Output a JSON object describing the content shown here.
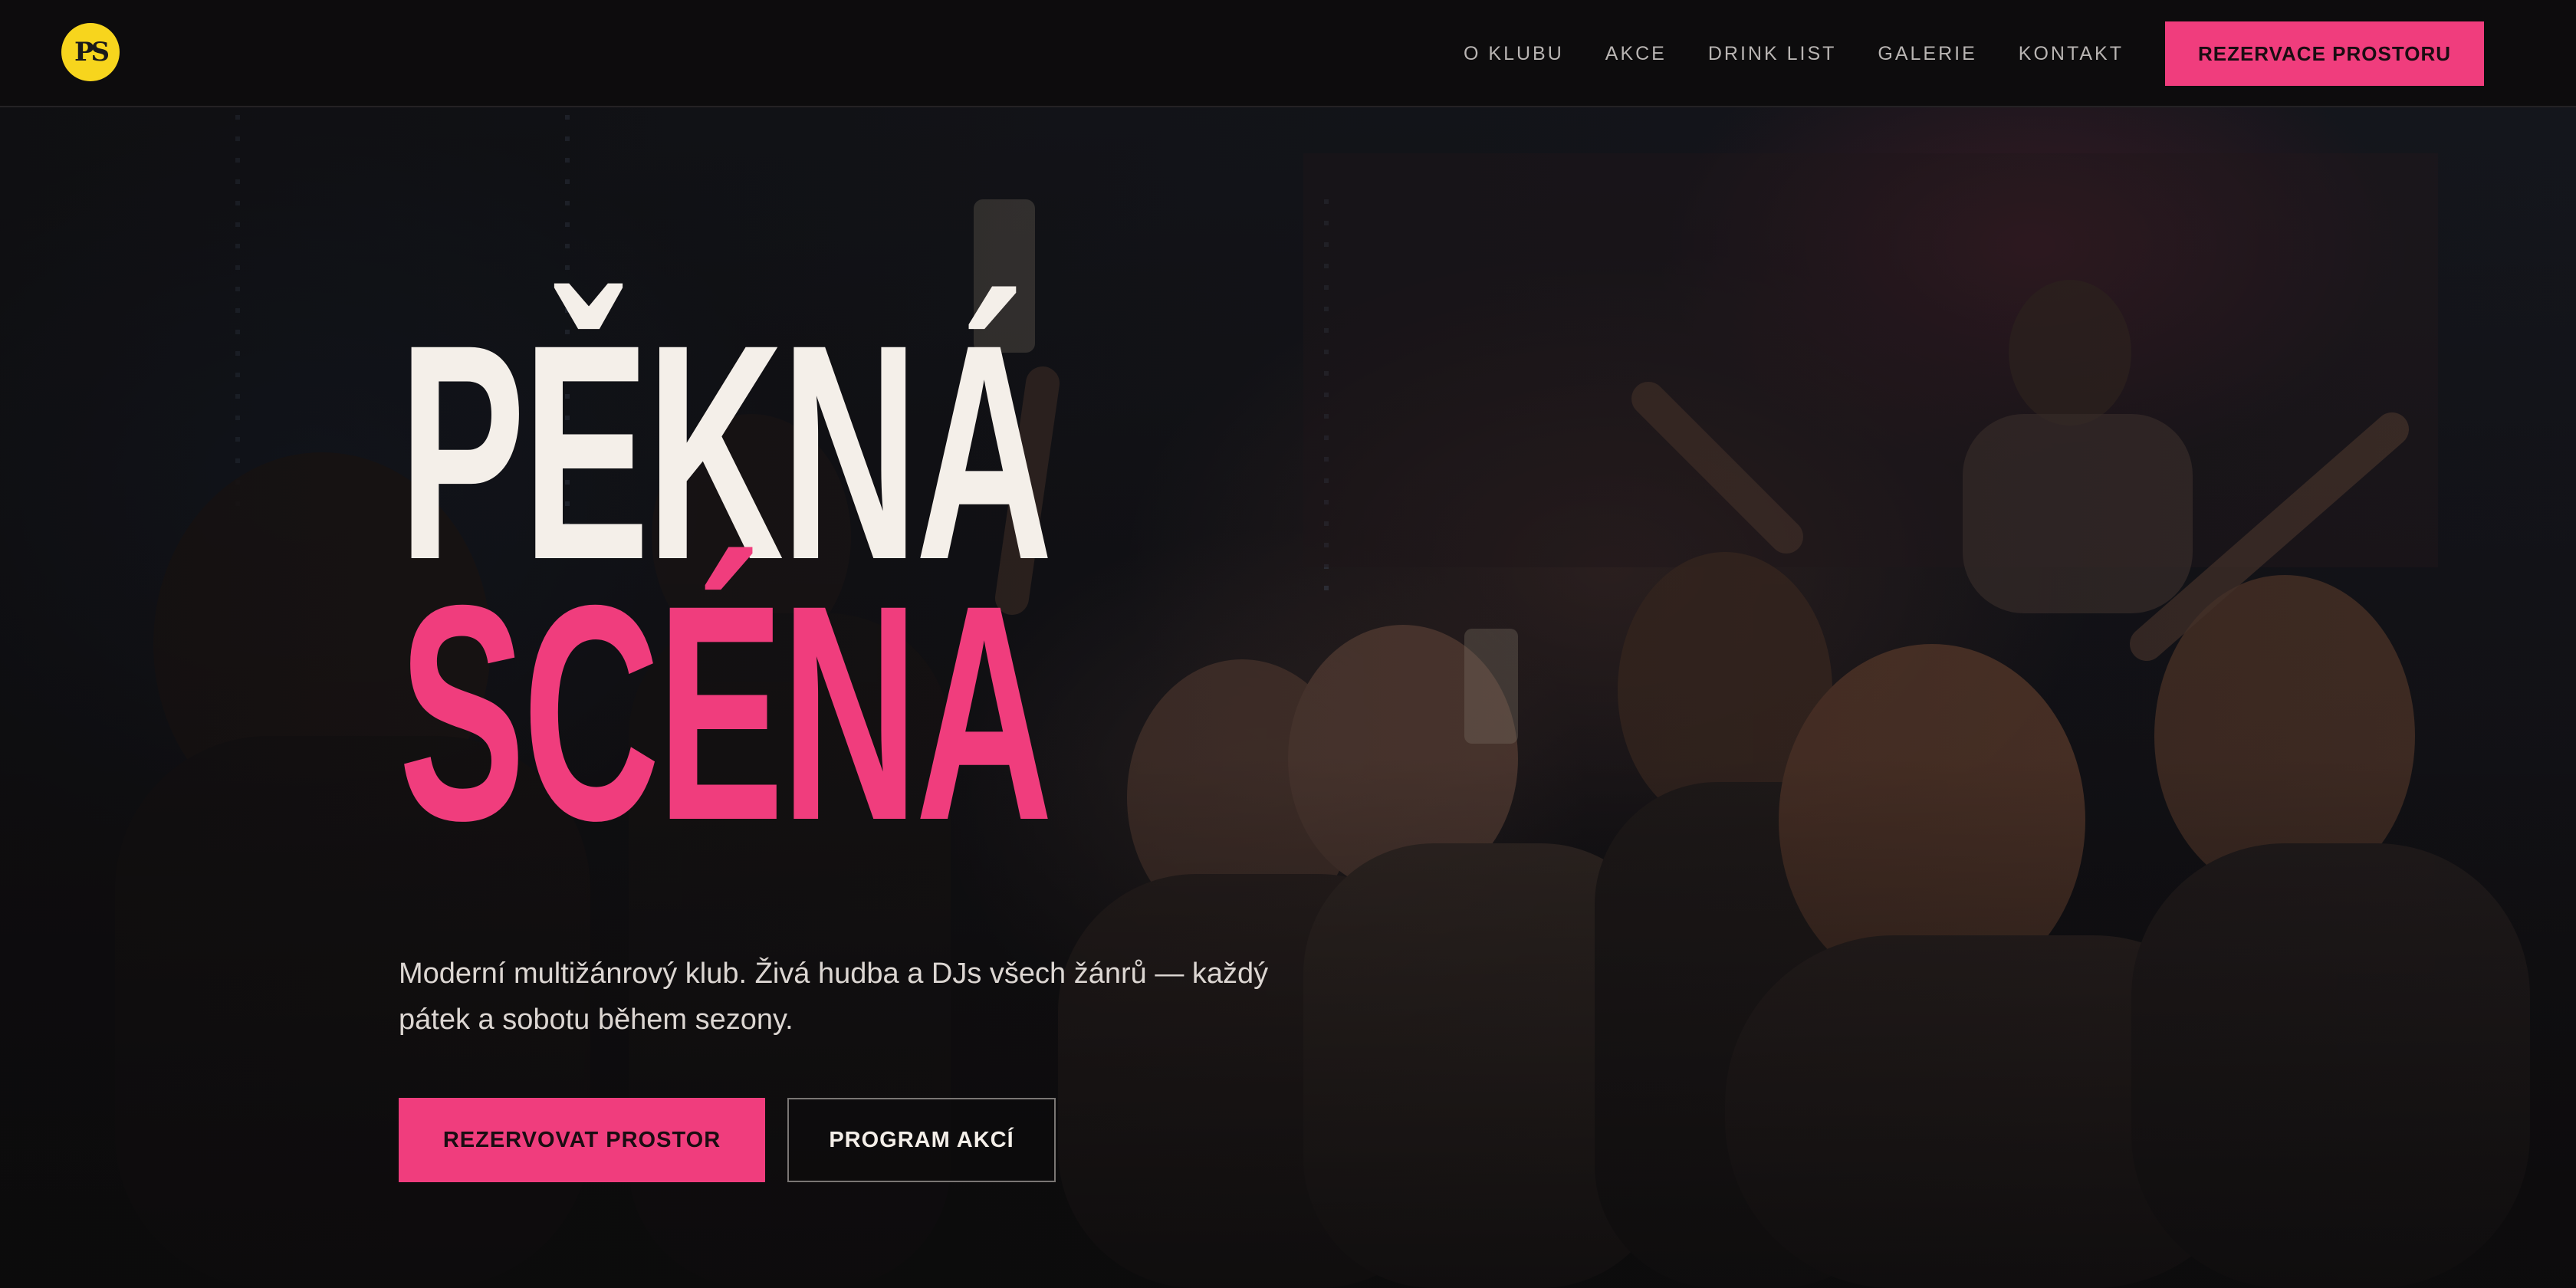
{
  "header": {
    "logo_text": "Pěkná Scéna logo",
    "nav": [
      {
        "label": "O KLUBU"
      },
      {
        "label": "AKCE"
      },
      {
        "label": "DRINK LIST"
      },
      {
        "label": "GALERIE"
      },
      {
        "label": "KONTAKT"
      }
    ],
    "cta_label": "REZERVACE PROSTORU"
  },
  "hero": {
    "title_line1": "PĚKNÁ",
    "title_line2": "SCÉNA",
    "subtitle": "Moderní multižánrový klub. Živá hudba a DJs všech žánrů — každý pátek a sobotu během sezony.",
    "primary_button": "REZERVOVAT PROSTOR",
    "secondary_button": "PROGRAM AKCÍ"
  },
  "colors": {
    "accent": "#f03d7d",
    "logo": "#f7d51d",
    "background": "#0c0b0c",
    "title": "#f4efe9"
  }
}
